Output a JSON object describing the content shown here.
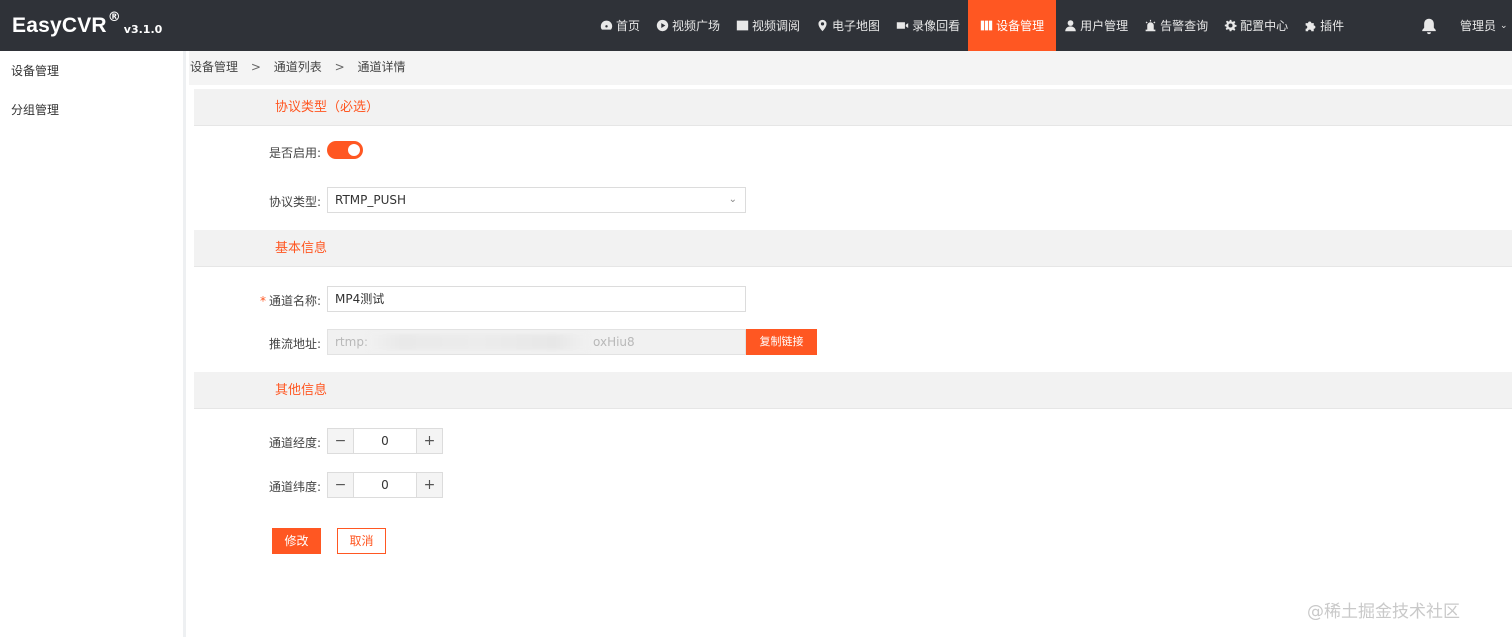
{
  "brand": {
    "name": "EasyCVR",
    "reg": "®",
    "version": "v3.1.0"
  },
  "nav": [
    {
      "label": "首页",
      "icon": "dashboard-icon"
    },
    {
      "label": "视频广场",
      "icon": "play-circle-icon"
    },
    {
      "label": "视频调阅",
      "icon": "grid-icon"
    },
    {
      "label": "电子地图",
      "icon": "map-pin-icon"
    },
    {
      "label": "录像回看",
      "icon": "video-camera-icon"
    },
    {
      "label": "设备管理",
      "icon": "columns-icon",
      "active": true
    },
    {
      "label": "用户管理",
      "icon": "user-icon"
    },
    {
      "label": "告警查询",
      "icon": "alarm-icon"
    },
    {
      "label": "配置中心",
      "icon": "gear-icon"
    },
    {
      "label": "插件",
      "icon": "puzzle-icon"
    }
  ],
  "header": {
    "user_label": "管理员",
    "bell_icon": "bell-icon"
  },
  "sidebar": {
    "items": [
      {
        "label": "设备管理"
      },
      {
        "label": "分组管理"
      }
    ]
  },
  "breadcrumb": {
    "items": [
      "设备管理",
      "通道列表",
      "通道详情"
    ],
    "separator": ">"
  },
  "sections": {
    "protocol": {
      "title": "协议类型（必选）"
    },
    "basic": {
      "title": "基本信息"
    },
    "other": {
      "title": "其他信息"
    }
  },
  "form": {
    "enabled": {
      "label": "是否启用:",
      "value": true
    },
    "protocol": {
      "label": "协议类型:",
      "value": "RTMP_PUSH"
    },
    "channel_name": {
      "label": "通道名称:",
      "required_mark": "*",
      "value": "MP4测试"
    },
    "push_url": {
      "label": "推流地址:",
      "value_prefix": "rtmp:",
      "value_suffix": "oxHiu8",
      "copy_label": "复制链接"
    },
    "longitude": {
      "label": "通道经度:",
      "value": "0",
      "minus": "−",
      "plus": "+"
    },
    "latitude": {
      "label": "通道纬度:",
      "value": "0",
      "minus": "−",
      "plus": "+"
    }
  },
  "actions": {
    "submit_label": "修改",
    "cancel_label": "取消"
  },
  "watermark": "@稀土掘金技术社区",
  "colors": {
    "accent": "#ff5722",
    "topbar": "#2f3238"
  }
}
